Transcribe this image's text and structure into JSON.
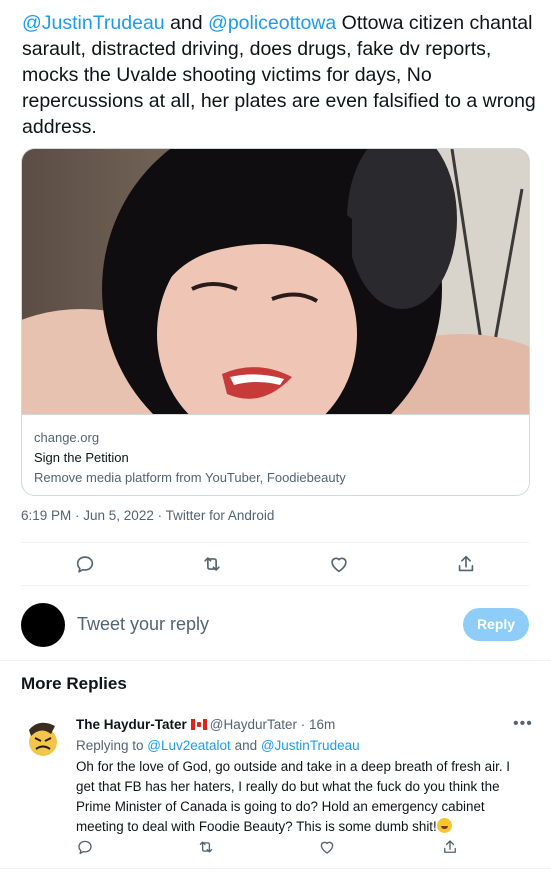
{
  "tweet": {
    "mention_1": "@JustinTrudeau",
    "text_1": " and ",
    "mention_2": "@policeottowa",
    "text_2": " Ottowa citizen chantal sarault,  distracted driving, does drugs, fake dv reports, mocks the Uvalde shooting victims for days, No repercussions at all, her plates are even falsified to a wrong address.",
    "timestamp": "6:19 PM · Jun 5, 2022 · Twitter for Android"
  },
  "card": {
    "domain": "change.org",
    "title": "Sign the Petition",
    "description": "Remove media platform from YouTuber, Foodiebeauty"
  },
  "actions": {
    "reply_icon": "reply-icon",
    "retweet_icon": "retweet-icon",
    "like_icon": "heart-icon",
    "share_icon": "share-icon"
  },
  "composer": {
    "placeholder": "Tweet your reply",
    "button_label": "Reply"
  },
  "more_replies": {
    "title": "More Replies"
  },
  "reply": {
    "name": "The Haydur-Tater",
    "handle": "@HaydurTater",
    "time": " · 16m",
    "more": "•••",
    "replying_prefix": "Replying to ",
    "replying_user_1": "@Luv2eatalot",
    "replying_and": " and ",
    "replying_user_2": "@JustinTrudeau",
    "text": "Oh for the love of God, go outside and take in a deep breath of fresh air. I get that FB has her haters, I really do but what the fuck do you think the Prime Minister of Canada is going to do? Hold an emergency cabinet meeting to deal with Foodie Beauty? This is some dumb shit!"
  },
  "colors": {
    "accent": "#1d9bf0",
    "reply_button": "#8ecdf8",
    "secondary_text": "#536471",
    "border": "#cfd9de"
  }
}
